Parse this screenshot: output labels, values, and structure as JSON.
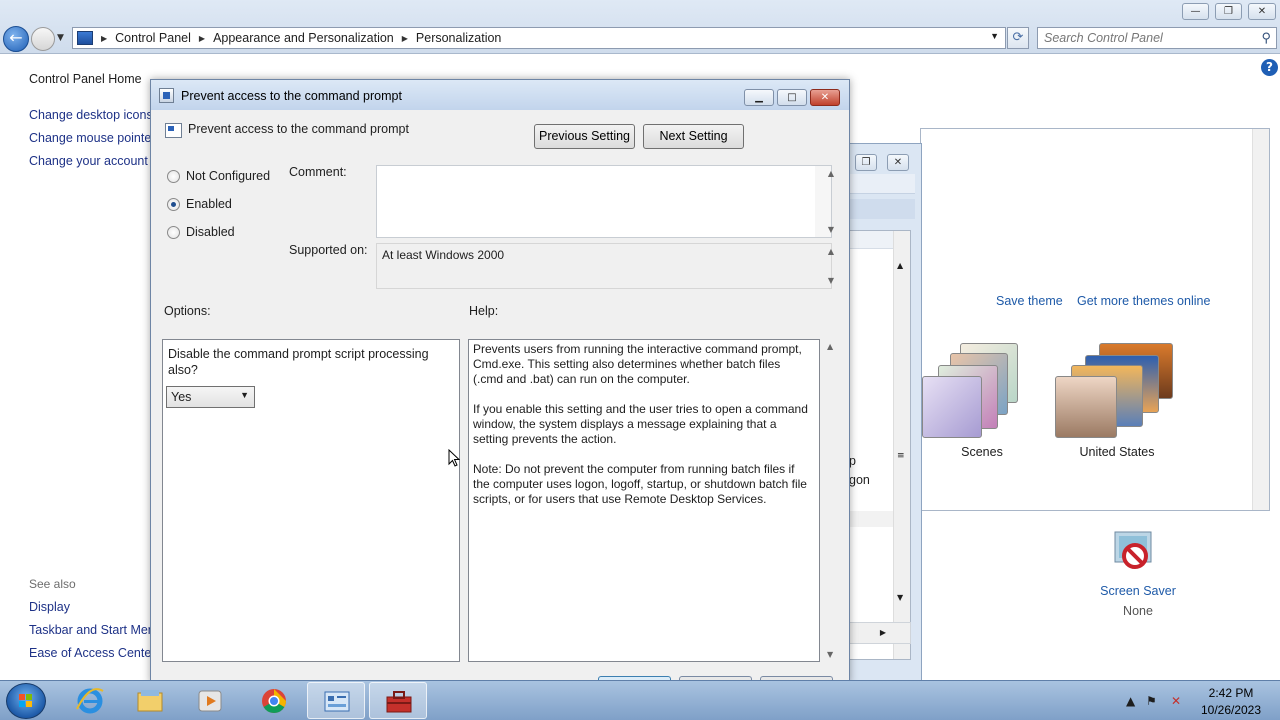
{
  "explorer": {
    "breadcrumbs": [
      "Control Panel",
      "Appearance and Personalization",
      "Personalization"
    ],
    "search_placeholder": "Search Control Panel",
    "window_buttons": [
      "minimize",
      "restore",
      "close"
    ]
  },
  "left_pane": {
    "home": "Control Panel Home",
    "links": [
      "Change desktop icons",
      "Change mouse pointers",
      "Change your account picture"
    ],
    "see_also_heading": "See also",
    "see_also": [
      "Display",
      "Taskbar and Start Menu",
      "Ease of Access Center"
    ]
  },
  "personalization": {
    "save_theme": "Save theme",
    "more_themes": "Get more themes online",
    "themes": [
      "Scenes",
      "United States"
    ],
    "screen_saver_label": "Screen Saver",
    "screen_saver_value": "None"
  },
  "gp_window": {
    "fragments": [
      "p",
      "gon"
    ]
  },
  "dialog": {
    "title": "Prevent access to the command prompt",
    "setting_name": "Prevent access to the command prompt",
    "previous_setting": "Previous Setting",
    "next_setting": "Next Setting",
    "radios": [
      {
        "label": "Not Configured",
        "checked": false
      },
      {
        "label": "Enabled",
        "checked": true
      },
      {
        "label": "Disabled",
        "checked": false
      }
    ],
    "comment_label": "Comment:",
    "comment_value": "",
    "supported_label": "Supported on:",
    "supported_value": "At least Windows 2000",
    "options_label": "Options:",
    "help_label": "Help:",
    "option_question": "Disable the command prompt script processing also?",
    "option_selected": "Yes",
    "help_paragraphs": [
      "Prevents users from running the interactive command prompt, Cmd.exe. This setting also determines whether batch files (.cmd and .bat) can run on the computer.",
      "If you enable this setting and the user tries to open a command window, the system displays a message explaining that a setting prevents the action.",
      "Note: Do not prevent the computer from running batch files if the computer uses logon, logoff, startup, or shutdown batch file scripts, or for users that use Remote Desktop Services."
    ]
  },
  "taskbar": {
    "apps": [
      "internet-explorer-icon",
      "windows-explorer-icon",
      "media-player-icon",
      "chrome-icon",
      "control-panel-icon",
      "toolbox-icon"
    ],
    "time": "2:42 PM",
    "date": "10/26/2023"
  },
  "colors": {
    "link": "#1e3287",
    "accent_link": "#1e5aa8",
    "title_gradient_top": "#dce8f6",
    "taskbar": "#7fa0c8",
    "close_red": "#c0412c"
  }
}
